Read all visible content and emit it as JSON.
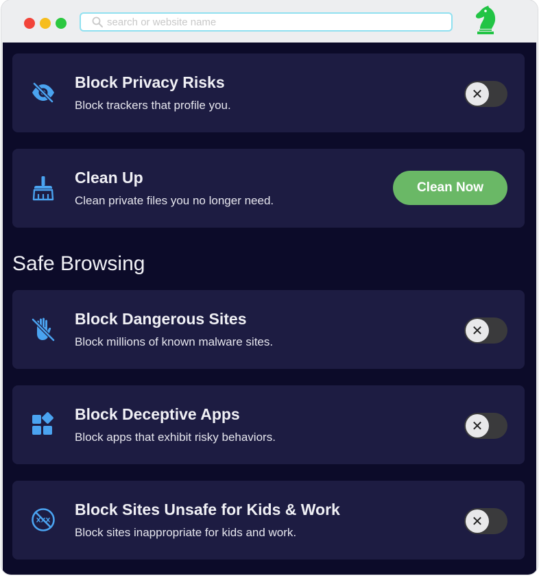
{
  "browser": {
    "search_placeholder": "search or website name",
    "search_value": ""
  },
  "colors": {
    "background": "#0c0b29",
    "card": "#1d1c42",
    "icon_blue": "#4aa3f0",
    "clean_button": "#6ab866",
    "logo_green": "#22c445",
    "toggle_off": "#3a3a3c"
  },
  "cards_top": [
    {
      "icon": "eye-slash-icon",
      "title": "Block Privacy Risks",
      "description": "Block trackers that profile you.",
      "control": "toggle",
      "enabled": false
    },
    {
      "icon": "broom-icon",
      "title": "Clean Up",
      "description": "Clean private files you no longer need.",
      "control": "button",
      "button_label": "Clean Now"
    }
  ],
  "safe_browsing": {
    "heading": "Safe Browsing",
    "cards": [
      {
        "icon": "hand-slash-icon",
        "title": "Block Dangerous Sites",
        "description": "Block millions of known malware sites.",
        "enabled": false
      },
      {
        "icon": "apps-icon",
        "title": "Block Deceptive Apps",
        "description": "Block apps that exhibit risky behaviors.",
        "enabled": false
      },
      {
        "icon": "xxx-blocked-icon",
        "title": "Block Sites Unsafe for Kids & Work",
        "description": "Block sites inappropriate for kids and work.",
        "enabled": false
      }
    ]
  },
  "toggle_glyph": "✕"
}
